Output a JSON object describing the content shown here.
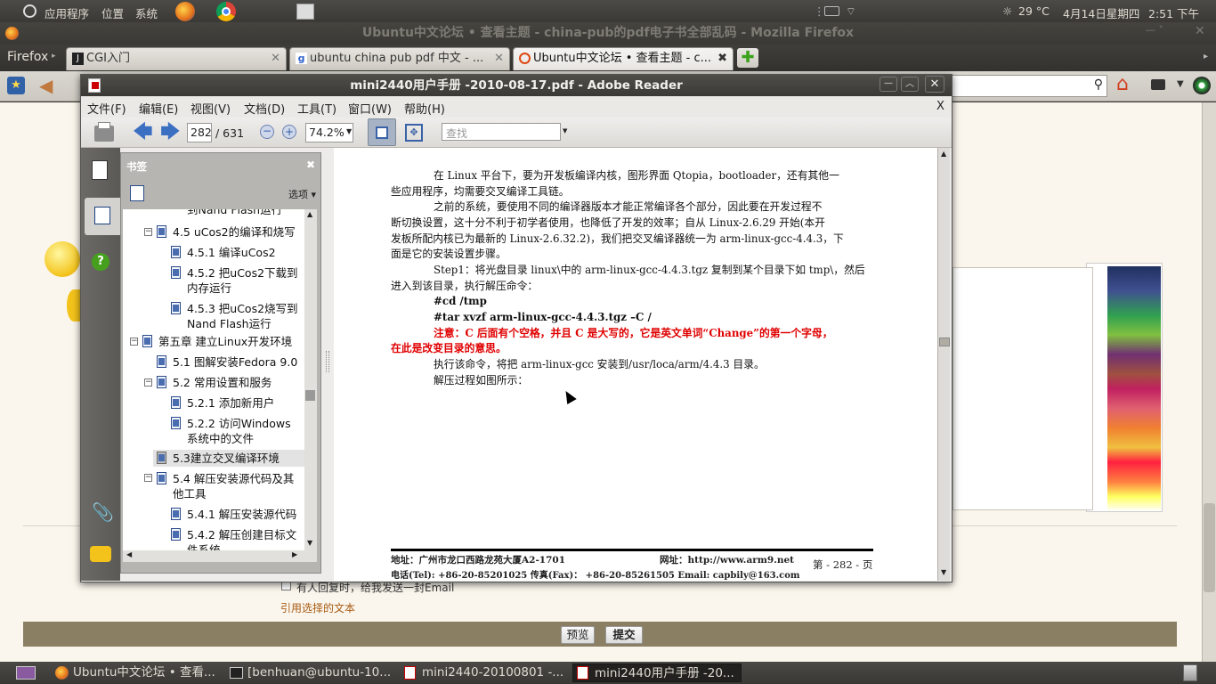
{
  "top_panel": {
    "apps": "应用程序",
    "places": "位置",
    "system": "系统",
    "temperature": "29 °C",
    "date": "4月14日星期四",
    "time": "2:51 下午"
  },
  "firefox": {
    "window_title": "Ubuntu中文论坛 • 查看主题 - china-pub的pdf电子书全部乱码 - Mozilla Firefox",
    "menu_label": "Firefox",
    "tabs": [
      {
        "label": "CGI入门"
      },
      {
        "label": "ubuntu china pub pdf 中文 - ..."
      },
      {
        "label": "Ubuntu中文论坛 • 查看主题 - c..."
      }
    ],
    "checkbox_label": "有人回复时，给我发送一封Email",
    "quote_link": "引用选择的文本",
    "preview_button": "预览",
    "submit_button": "提交"
  },
  "reader": {
    "title": "mini2440用户手册 -2010-08-17.pdf - Adobe Reader",
    "menus": [
      "文件(F)",
      "编辑(E)",
      "视图(V)",
      "文档(D)",
      "工具(T)",
      "窗口(W)",
      "帮助(H)"
    ],
    "page_current": "282",
    "page_total": "/ 631",
    "zoom": "74.2%",
    "find_placeholder": "查找",
    "close_doc": "X",
    "bookmark_title": "书签",
    "options": "选项",
    "bookmarks": [
      "到Nand Flash运行",
      "4.5 uCos2的编译和烧写",
      "4.5.1 编译uCos2",
      "4.5.2 把uCos2下载到",
      "内存运行",
      "4.5.3 把uCos2烧写到",
      "Nand Flash运行",
      "第五章 建立Linux开发环境",
      "5.1 图解安装Fedora 9.0",
      "5.2 常用设置和服务",
      "5.2.1 添加新用户",
      "5.2.2 访问Windows",
      "系统中的文件",
      "5.3建立交叉编译环境",
      "5.4 解压安装源代码及其",
      "他工具",
      "5.4.1 解压安装源代码",
      "5.4.2 解压创建目标文",
      "件系统"
    ],
    "doc_lines": [
      "在 Linux 平台下，要为开发板编译内核，图形界面 Qtopia，bootloader，还有其他一",
      "些应用程序，均需要交叉编译工具链。",
      "之前的系统，要使用不同的编译器版本才能正常编译各个部分，因此要在开发过程不",
      "断切换设置，这十分不利于初学者使用，也降低了开发的效率；自从 Linux-2.6.29 开始(本开",
      "发板所配内核已为最新的 Linux-2.6.32.2)，我们把交叉编译器统一为 arm-linux-gcc-4.4.3，下",
      "面是它的安装设置步骤。",
      "Step1：将光盘目录 linux\\中的 arm-linux-gcc-4.4.3.tgz 复制到某个目录下如 tmp\\，然后",
      "进入到该目录，执行解压命令：",
      "#cd /tmp",
      "#tar xvzf arm-linux-gcc-4.4.3.tgz    –C /",
      "注意：C 后面有个空格，并且 C 是大写的，它是英文单词“Change”的第一个字母，",
      "在此是改变目录的意思。",
      "执行该命令，将把 arm-linux-gcc 安装到/usr/loca/arm/4.4.3 目录。",
      "解压过程如图所示："
    ],
    "footer_addr": "地址：广州市龙口西路龙苑大厦A2-1701",
    "footer_web": "网址：http://www.arm9.net",
    "footer_phone": "电话(Tel): +86-20-85201025  传真(Fax)： +86-20-85261505  Email: capbily@163.com",
    "footer_page": "第 - 282 - 页"
  },
  "taskbar": [
    {
      "label": "Ubuntu中文论坛 • 查看..."
    },
    {
      "label": "[benhuan@ubuntu-10..."
    },
    {
      "label": "mini2440-20100801 -..."
    },
    {
      "label": "mini2440用户手册 -20..."
    }
  ]
}
